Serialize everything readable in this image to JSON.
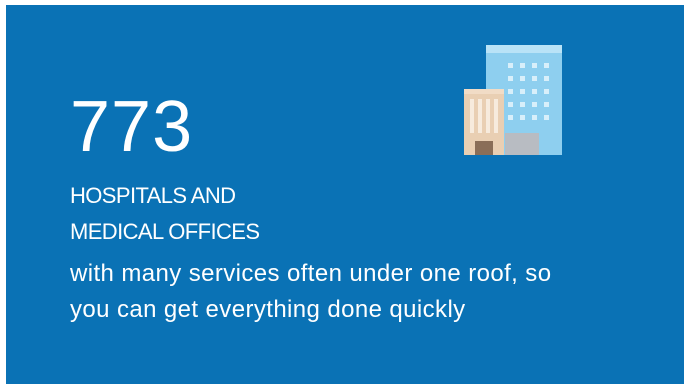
{
  "stat": {
    "value": "773",
    "title_lines": [
      "HOSPITALS AND",
      "MEDICAL OFFICES"
    ],
    "description_lines": [
      "with many services often under one roof, so",
      "you can get everything done quickly"
    ],
    "icon": "hospital-building-icon"
  },
  "colors": {
    "background": "#0a72b5",
    "text": "#ffffff",
    "tower": "#8ecfef",
    "tower_top": "#b9e3f7",
    "annex": "#e9cfb3",
    "door": "#8a6e58",
    "garage": "#b8bcc2"
  }
}
